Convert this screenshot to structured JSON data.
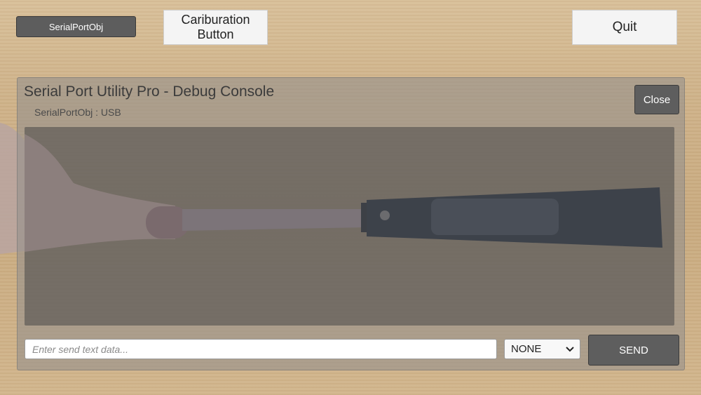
{
  "top_bar": {
    "serial_port_label": "SerialPortObj",
    "calibration_label": "Cariburation\nButton",
    "quit_label": "Quit"
  },
  "console": {
    "title": "Serial Port Utility Pro - Debug Console",
    "subtitle": "SerialPortObj : USB",
    "close_label": "Close"
  },
  "send_bar": {
    "input_value": "",
    "input_placeholder": "Enter send text data...",
    "mode_selected": "NONE",
    "send_label": "SEND"
  },
  "icons": {
    "mode_dropdown": "chevron-down-icon"
  },
  "colors": {
    "dark_button": "#5e5e5e",
    "light_button": "#f4f4f4",
    "console_panel": "#96918c"
  }
}
